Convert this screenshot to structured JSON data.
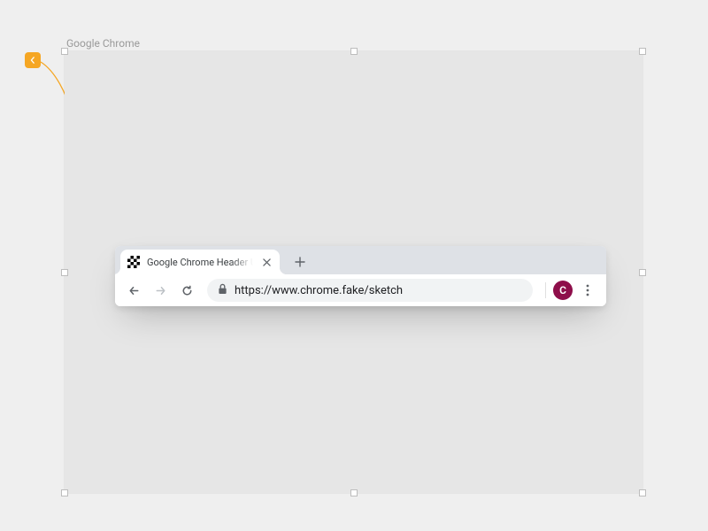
{
  "artboard": {
    "label": "Google Chrome"
  },
  "connector": {
    "color": "#f5a623"
  },
  "chrome": {
    "tab": {
      "title": "Google Chrome Header UI Freebie"
    },
    "url": "https://www.chrome.fake/sketch",
    "avatar_initial": "C",
    "avatar_bg": "#8e0e4a"
  }
}
